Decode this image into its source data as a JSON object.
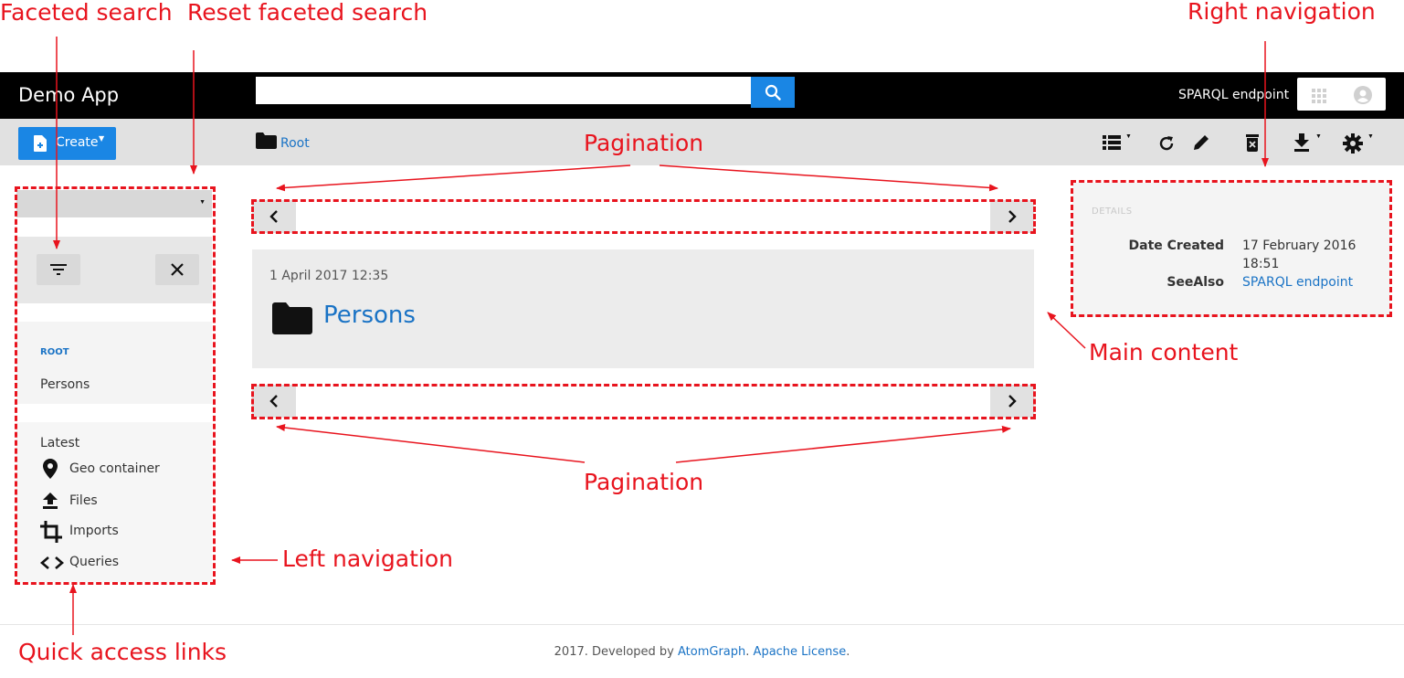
{
  "annotations": {
    "faceted_search": "Faceted search",
    "reset_faceted_search": "Reset faceted search",
    "right_navigation": "Right navigation",
    "pagination_top": "Pagination",
    "pagination_bottom": "Pagination",
    "main_content": "Main content",
    "left_navigation": "Left navigation",
    "quick_access_links": "Quick access links"
  },
  "colors": {
    "annotation": "#e8141e",
    "primary": "#1a86e4",
    "link": "#1a73c5",
    "navbar": "#000000"
  },
  "navbar": {
    "brand": "Demo App",
    "search": {
      "value": "",
      "placeholder": "",
      "button_icon": "search-icon"
    },
    "sparql_link": "SPARQL endpoint",
    "icons": [
      "apps-icon",
      "user-account-icon"
    ]
  },
  "actionbar": {
    "create_label": "Create",
    "breadcrumb": "Root",
    "icons": [
      "list-view-icon",
      "refresh-icon",
      "edit-icon",
      "delete-icon",
      "download-icon",
      "settings-icon"
    ]
  },
  "left_nav": {
    "root_label": "ROOT",
    "root_item": "Persons",
    "latest_label": "Latest",
    "quick_links": [
      {
        "label": "Geo container",
        "icon": "map-marker-icon"
      },
      {
        "label": "Files",
        "icon": "upload-icon"
      },
      {
        "label": "Imports",
        "icon": "crop-icon"
      },
      {
        "label": "Queries",
        "icon": "code-icon"
      }
    ]
  },
  "main": {
    "item": {
      "date": "1 April 2017 12:35",
      "title": "Persons",
      "icon": "folder-icon"
    }
  },
  "details": {
    "heading": "DETAILS",
    "date_created_label": "Date Created",
    "date_created_value_line1": "17 February 2016",
    "date_created_value_line2": "18:51",
    "see_also_label": "SeeAlso",
    "see_also_value": "SPARQL endpoint"
  },
  "footer": {
    "prefix": "2017. Developed by",
    "company": "AtomGraph",
    "sep": ".",
    "license": "Apache License",
    "suffix": "."
  }
}
